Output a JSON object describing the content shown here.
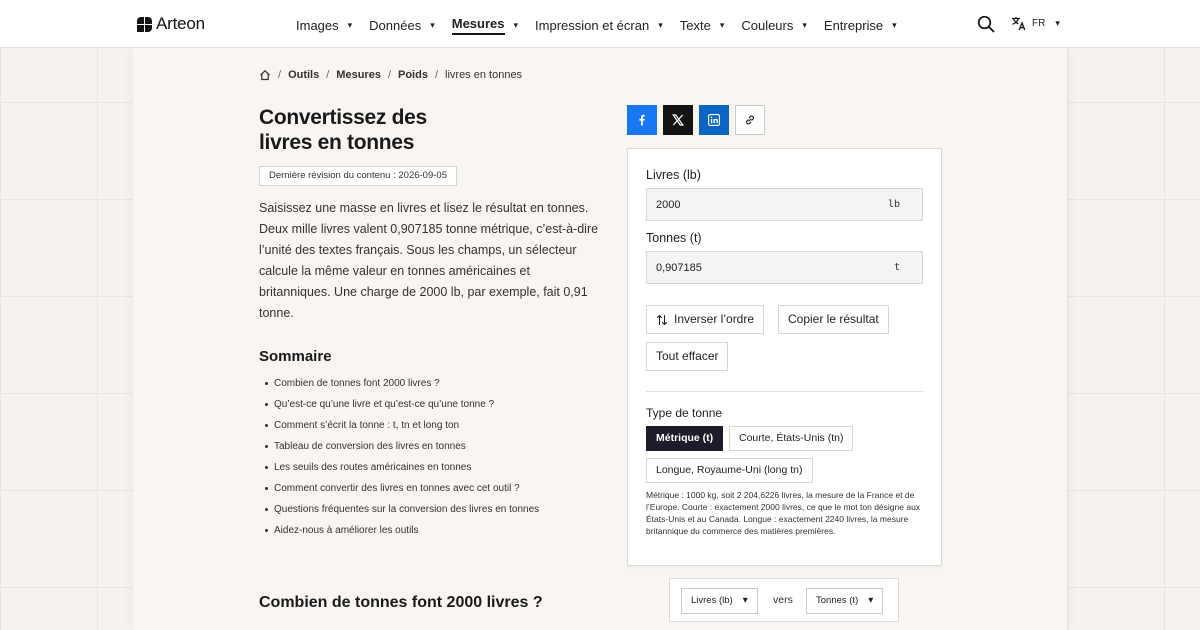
{
  "brand": {
    "name": "Arteon"
  },
  "nav": {
    "items": [
      {
        "label": "Images"
      },
      {
        "label": "Données"
      },
      {
        "label": "Mesures",
        "active": true
      },
      {
        "label": "Impression et écran"
      },
      {
        "label": "Texte"
      },
      {
        "label": "Couleurs"
      },
      {
        "label": "Entreprise"
      }
    ],
    "caret": "▾",
    "search_icon": "search-icon",
    "language": {
      "code": "FR",
      "icon": "translate-icon"
    }
  },
  "breadcrumb": {
    "home_icon": "home-icon",
    "items": [
      "Outils",
      "Mesures",
      "Poids"
    ],
    "current": "livres en tonnes",
    "sep": "/"
  },
  "page": {
    "title_line1": "Convertissez des",
    "title_line2": "livres en tonnes",
    "revision": "Dernière révision du contenu : 2026-09-05",
    "intro": "Saisissez une masse en livres et lisez le résultat en tonnes. Deux mille livres valent 0,907185 tonne métrique, c’est-à-dire l’unité des textes français. Sous les champs, un sélecteur calcule la même valeur en tonnes américaines et britanniques. Une charge de 2000 lb, par exemple, fait 0,91 tonne.",
    "summary_title": "Sommaire",
    "summary": [
      "Combien de tonnes font 2000 livres ?",
      "Qu’est-ce qu’une livre et qu’est-ce qu’une tonne ?",
      "Comment s’écrit la tonne : t, tn et long ton",
      "Tableau de conversion des livres en tonnes",
      "Les seuils des routes américaines en tonnes",
      "Comment convertir des livres en tonnes avec cet outil ?",
      "Questions fréquentes sur la conversion des livres en tonnes",
      "Aidez-nous à améliorer les outils"
    ],
    "section_heading": "Combien de tonnes font 2000 livres ?"
  },
  "share": {
    "icons": [
      "facebook-icon",
      "x-icon",
      "linkedin-icon",
      "link-icon"
    ]
  },
  "converter": {
    "from_label": "Livres (lb)",
    "from_value": "2000",
    "from_unit": "lb",
    "to_label": "Tonnes (t)",
    "to_value": "0,907185",
    "to_unit": "t",
    "swap_label": "Inverser l’ordre",
    "copy_label": "Copier le résultat",
    "clear_label": "Tout effacer",
    "type_label": "Type de tonne",
    "types": [
      {
        "label": "Métrique (t)",
        "active": true
      },
      {
        "label": "Courte, États-Unis (tn)"
      },
      {
        "label": "Longue, Royaume-Uni (long tn)"
      }
    ],
    "type_note": "Métrique : 1000 kg, soit 2 204,6226 livres, la mesure de la France et de l’Europe. Courte : exactement 2000 livres, ce que le mot ton désigne aux États-Unis et au Canada. Longue : exactement 2240 livres, la mesure britannique du commerce des matières premières."
  },
  "unit_selector": {
    "from": "Livres (lb)",
    "to": "Tonnes (t)",
    "vers": "vers",
    "caret": "▾"
  },
  "colors": {
    "facebook": "#1877f2",
    "x": "#141414",
    "linkedin": "#0a66c2",
    "active_chip": "#1c1c2a"
  }
}
